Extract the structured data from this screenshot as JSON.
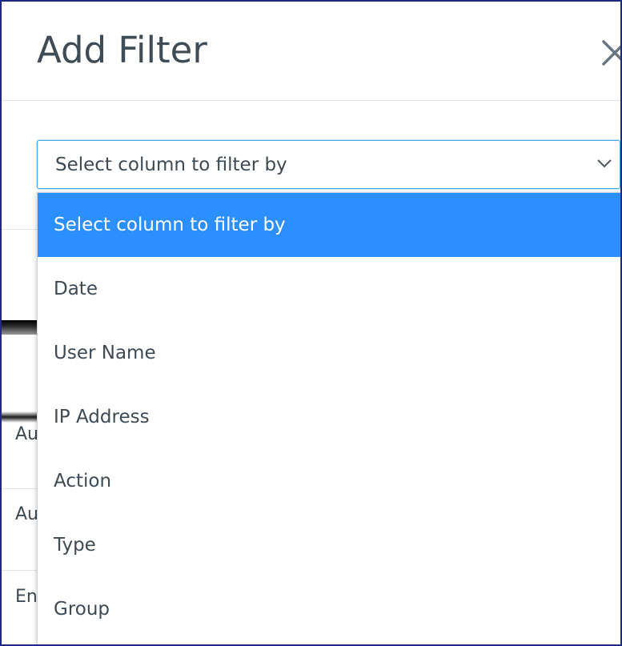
{
  "modal": {
    "title": "Add Filter",
    "close_icon": "close-icon"
  },
  "select": {
    "value": "Select column to filter by",
    "chevron_icon": "chevron-down-icon",
    "accent_color": "#3fa7f0"
  },
  "dropdown": {
    "selected_color": "#2c8fff",
    "options": [
      {
        "label": "Select column to filter by",
        "selected": true
      },
      {
        "label": "Date",
        "selected": false
      },
      {
        "label": "User Name",
        "selected": false
      },
      {
        "label": "IP Address",
        "selected": false
      },
      {
        "label": "Action",
        "selected": false
      },
      {
        "label": "Type",
        "selected": false
      },
      {
        "label": "Group",
        "selected": false
      }
    ]
  },
  "background": {
    "rows": [
      "Au",
      "Au",
      "En"
    ]
  }
}
